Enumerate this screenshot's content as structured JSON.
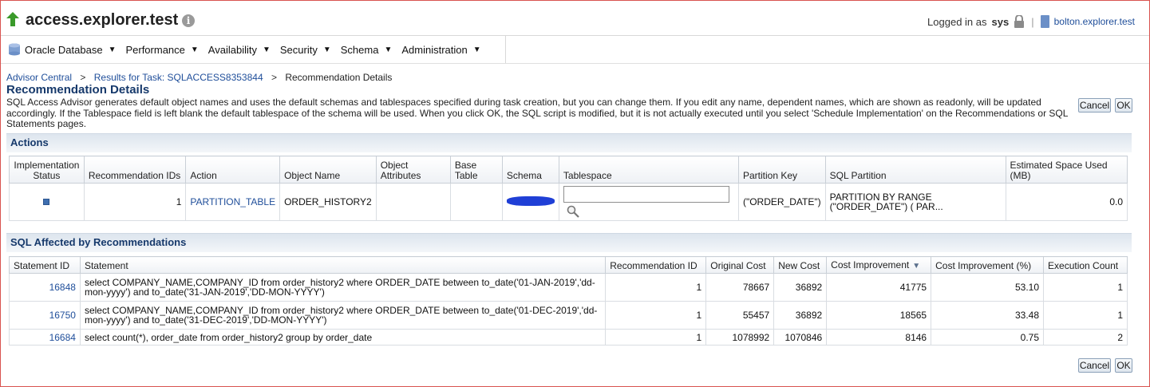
{
  "header": {
    "title": "access.explorer.test",
    "info_icon": "i",
    "login_prefix": "Logged in as",
    "login_user": "sys",
    "login_separator": "|",
    "host_link": "bolton.explorer.test"
  },
  "menu": {
    "items": [
      {
        "label": "Oracle Database"
      },
      {
        "label": "Performance"
      },
      {
        "label": "Availability"
      },
      {
        "label": "Security"
      },
      {
        "label": "Schema"
      },
      {
        "label": "Administration"
      }
    ],
    "caret": "▼"
  },
  "breadcrumb": {
    "item1": "Advisor Central",
    "item2": "Results for Task: SQLACCESS8353844",
    "current": "Recommendation Details",
    "separator": ">"
  },
  "page": {
    "title": "Recommendation Details",
    "description": "SQL Access Advisor generates default object names and uses the default schemas and tablespaces specified during task creation, but you can change them. If you edit any name, dependent names, which are shown as readonly, will be updated accordingly. If the Tablespace field is left blank the default tablespace of the schema will be used. When you click OK, the SQL script is modified, but it is not actually executed until you select 'Schedule Implementation' on the Recommendations or SQL Statements pages."
  },
  "buttons": {
    "cancel": "Cancel",
    "ok": "OK"
  },
  "actions": {
    "section_title": "Actions",
    "headers": {
      "status": "Implementation Status",
      "rec_ids": "Recommendation IDs",
      "action": "Action",
      "object_name": "Object Name",
      "object_attributes": "Object Attributes",
      "base_table": "Base Table",
      "schema": "Schema",
      "tablespace": "Tablespace",
      "partition_key": "Partition Key",
      "sql_partition": "SQL Partition",
      "space": "Estimated Space Used (MB)"
    },
    "row": {
      "rec_ids": "1",
      "action": "PARTITION_TABLE",
      "object_name": "ORDER_HISTORY2",
      "object_attributes": "",
      "base_table": "",
      "tablespace_value": "",
      "partition_key": "(\"ORDER_DATE\")",
      "sql_partition": "PARTITION BY RANGE (\"ORDER_DATE\") ( PAR...",
      "space": "0.0"
    }
  },
  "sql_affected": {
    "section_title": "SQL Affected by Recommendations",
    "headers": {
      "statement_id": "Statement ID",
      "statement": "Statement",
      "rec_id": "Recommendation ID",
      "original_cost": "Original Cost",
      "new_cost": "New Cost",
      "cost_improvement": "Cost Improvement",
      "cost_improvement_pct": "Cost Improvement (%)",
      "execution_count": "Execution Count"
    },
    "sort_icon": "▼",
    "rows": [
      {
        "statement_id": "16848",
        "statement": "select COMPANY_NAME,COMPANY_ID from order_history2 where ORDER_DATE between to_date('01-JAN-2019','dd-mon-yyyy') and to_date('31-JAN-2019','DD-MON-YYYY')",
        "rec_id": "1",
        "original_cost": "78667",
        "new_cost": "36892",
        "cost_improvement": "41775",
        "cost_improvement_pct": "53.10",
        "execution_count": "1"
      },
      {
        "statement_id": "16750",
        "statement": "select COMPANY_NAME,COMPANY_ID from order_history2 where ORDER_DATE between to_date('01-DEC-2019','dd-mon-yyyy') and to_date('31-DEC-2019','DD-MON-YYYY')",
        "rec_id": "1",
        "original_cost": "55457",
        "new_cost": "36892",
        "cost_improvement": "18565",
        "cost_improvement_pct": "33.48",
        "execution_count": "1"
      },
      {
        "statement_id": "16684",
        "statement": "select count(*), order_date from order_history2 group by order_date",
        "rec_id": "1",
        "original_cost": "1078992",
        "new_cost": "1070846",
        "cost_improvement": "8146",
        "cost_improvement_pct": "0.75",
        "execution_count": "2"
      }
    ]
  },
  "colors": {
    "title_blue": "#16396b",
    "link_blue": "#1f4e9a",
    "up_arrow_green": "#3a9a2a",
    "redaction": "#1f3fd6"
  }
}
